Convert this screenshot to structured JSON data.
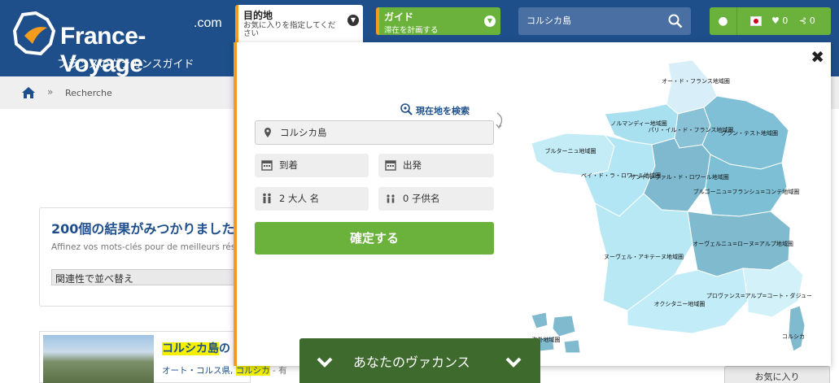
{
  "header": {
    "logo_text": "France-Voyage",
    "logo_com": ".com",
    "logo_sub": "フランスのヴァカンスガイド",
    "destination_tab": {
      "title": "目的地",
      "subtitle": "お気に入りを指定してください"
    },
    "guide_button": {
      "title": "ガイド",
      "subtitle": "滞在を計画する"
    },
    "search": {
      "value": "コルシカ島"
    },
    "account": {
      "favorites_count": "0",
      "share_count": "0"
    }
  },
  "breadcrumb": {
    "current": "Recherche",
    "separator": "»"
  },
  "results": {
    "title": "200個の結果がみつかりました",
    "subtitle": "Affinez vos mots-clés pour de meilleurs résultats",
    "sort_value": "関連性で並べ替え"
  },
  "listing": {
    "title_highlight": "コルシカ島",
    "title_rest": "の",
    "meta_prefix": "オート・コルス県, ",
    "meta_highlight": "コルシカ",
    "meta_suffix": " - 有"
  },
  "favorite_button": "お気に入り",
  "destination_panel": {
    "geolocate_label": "現在地を検索",
    "location_value": "コルシカ島",
    "arrival_label": "到着",
    "departure_label": "出発",
    "adults_label": "2 大人 名",
    "children_label": "0 子供名",
    "confirm_label": "確定する",
    "map_regions": [
      "オー・ド・フランス地域圏",
      "ノルマンディー地域圏",
      "パリ・イル・ド・フランス地域圏",
      "グラン・テスト地域圏",
      "ブルターニュ地域圏",
      "ペイ・ド・ラ・ロワール地域圏",
      "サントル-ヴァル・ド・ロワール地域圏",
      "ブルゴーニュ=フランシュ=コンテ地域圏",
      "ヌーヴェル・アキテーヌ地域圏",
      "オーヴェルニュ=ローヌ=アルプ地域圏",
      "オクシタニー地域圏",
      "プロヴァンス=アルプ=コート・ダジュール地域圏",
      "海外地域圏",
      "コルシカ"
    ]
  },
  "vacation_bar": {
    "label": "あなたのヴァカンス"
  },
  "colors": {
    "header_blue": "#1f4f8b",
    "green": "#6ab23c",
    "orange": "#f39c1e",
    "dark_green": "#3f6a2e"
  }
}
